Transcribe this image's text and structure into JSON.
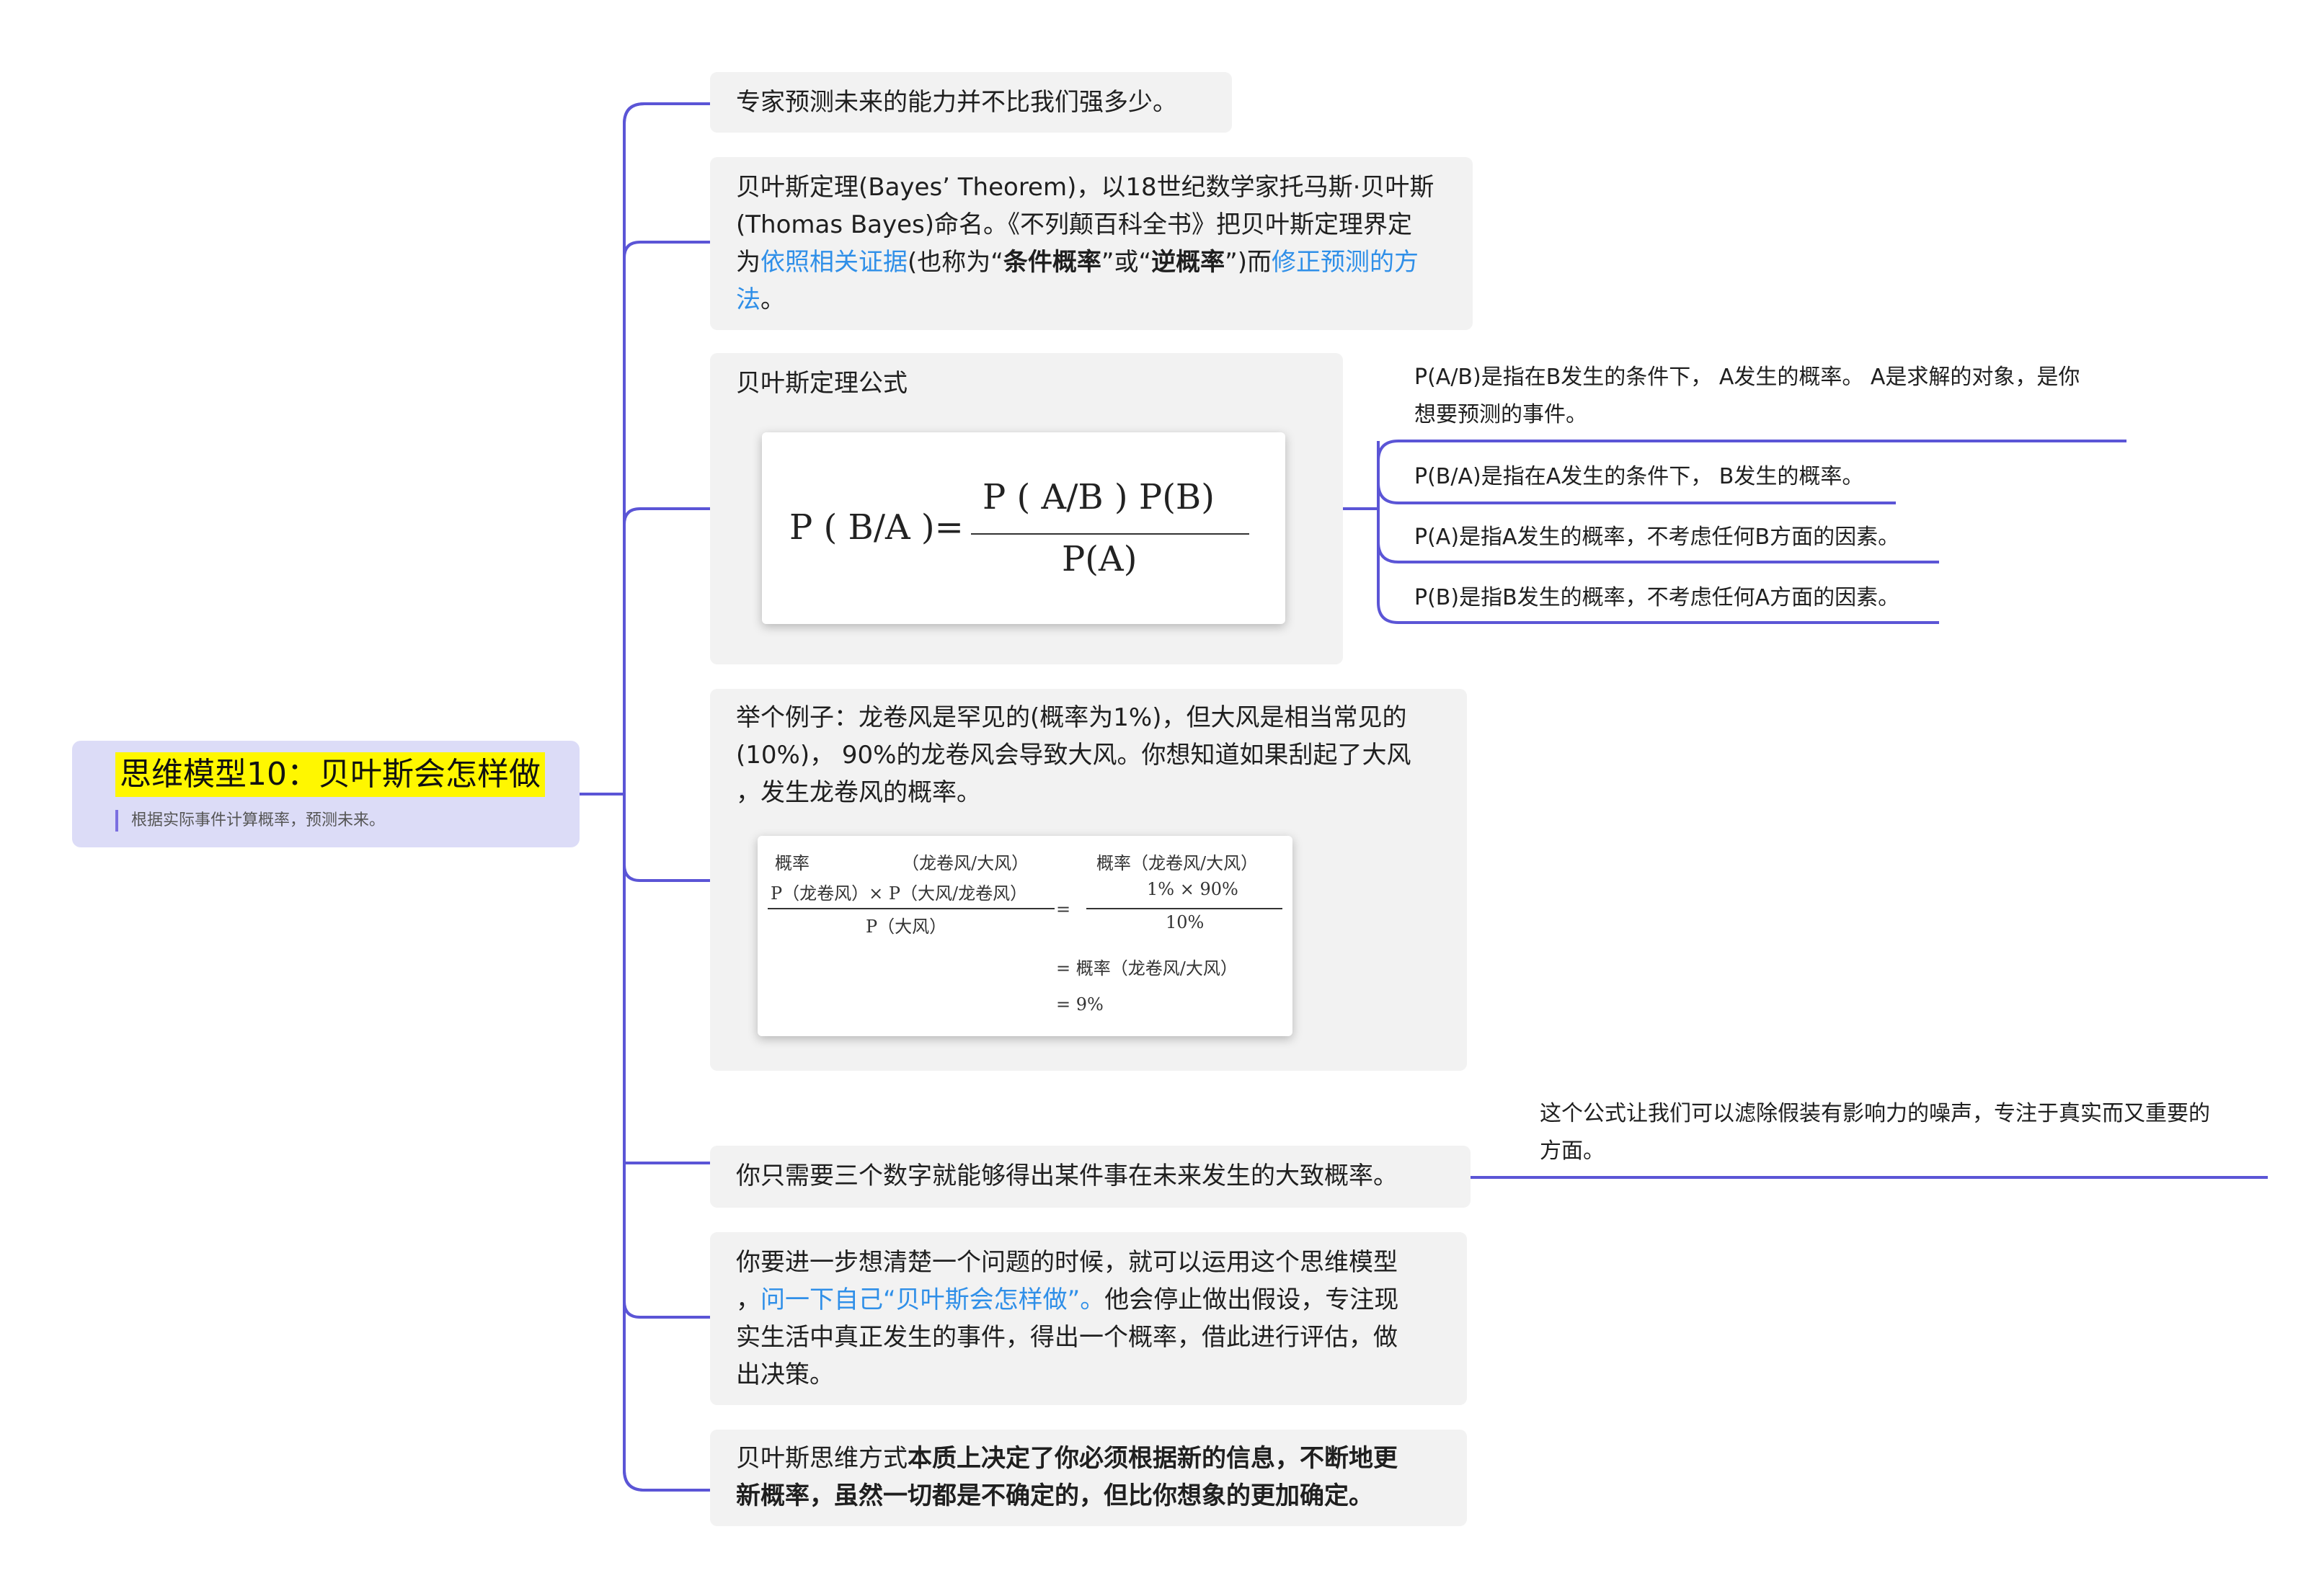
{
  "root": {
    "title": "思维模型10：贝叶斯会怎样做",
    "subtitle": "根据实际事件计算概率，预测未来。"
  },
  "n1": {
    "text": "专家预测未来的能力并不比我们强多少。"
  },
  "n2": {
    "l1": "贝叶斯定理(Bayes’ Theorem)，以18世纪数学家托马斯·贝叶斯",
    "l2": "(Thomas Bayes)命名。《不列颠百科全书》把贝叶斯定理界定",
    "l3_a": "为",
    "l3_link1": "依照相关证据",
    "l3_b": "(也称为“",
    "l3_bold1": "条件概率",
    "l3_c": "”或“",
    "l3_bold2": "逆概率",
    "l3_d": "”)而",
    "l3_link2": "修正预测的方",
    "l4_link": "法",
    "l4_end": "。"
  },
  "n3": {
    "title": "贝叶斯定理公式",
    "formula": {
      "lhs": "P ( B/A )=",
      "numerator": "P ( A/B ) P(B)",
      "denominator": "P(A)"
    },
    "notes": [
      {
        "l1": "P(A/B)是指在B发生的条件下， A发生的概率。 A是求解的对象，是你",
        "l2": "想要预测的事件。"
      },
      {
        "l1": "P(B/A)是指在A发生的条件下， B发生的概率。"
      },
      {
        "l1": "P(A)是指A发生的概率，不考虑任何B方面的因素。"
      },
      {
        "l1": "P(B)是指B发生的概率，不考虑任何A方面的因素。"
      }
    ]
  },
  "n4": {
    "l1": "举个例子：龙卷风是罕见的(概率为1%)，但大风是相当常见的",
    "l2": "(10%)， 90%的龙卷风会导致大风。你想知道如果刮起了大风",
    "l3": "，发生龙卷风的概率。",
    "example": {
      "r1_left": "概率",
      "r1_mid": "（龙卷风/大风）",
      "r1_right": "概率（龙卷风/大风）",
      "num_left": "P（龙卷风）× P（大风/龙卷风）",
      "den_left": "P（大风）",
      "eq1": "=",
      "num_right": "1% × 90%",
      "den_right": "10%",
      "row3": "=  概率（龙卷风/大风）",
      "row4": "=  9%"
    }
  },
  "n5": {
    "text": "你只需要三个数字就能够得出某件事在未来发生的大致概率。",
    "note_l1": "这个公式让我们可以滤除假装有影响力的噪声，专注于真实而又重要的",
    "note_l2": "方面。"
  },
  "n6": {
    "l1": "你要进一步想清楚一个问题的时候，就可以运用这个思维模型",
    "l2_a": "，",
    "l2_link": "问一下自己“贝叶斯会怎样做”。",
    "l2_b": "他会停止做出假设，专注现",
    "l3": "实生活中真正发生的事件，得出一个概率，借此进行评估，做",
    "l4": "出决策。"
  },
  "n7": {
    "l1_a": "贝叶斯思维方式",
    "l1_bold": "本质上决定了你必须根据新的信息，不断地更",
    "l2_bold": "新概率，虽然一切都是不确定的，但比你想象的更加确定。"
  },
  "colors": {
    "line": "#5b55d6",
    "root_bg": "#dcdcf7",
    "highlight": "#fff700",
    "link": "#2f8fe8",
    "node_bg": "#f2f2f2"
  }
}
